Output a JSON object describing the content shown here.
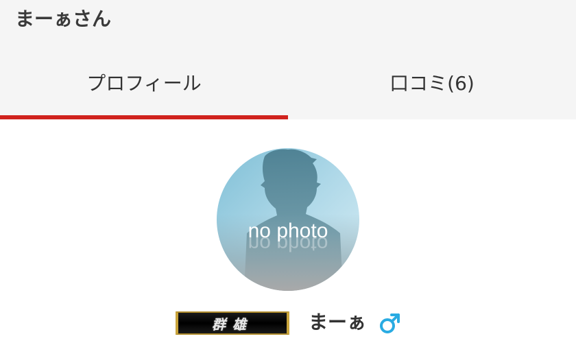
{
  "header": {
    "title": "まーぁさん"
  },
  "tabs": [
    {
      "label": "プロフィール",
      "active": true
    },
    {
      "label": "口コミ(6)",
      "active": false
    }
  ],
  "profile": {
    "avatar_text": "no photo",
    "rank_label": "群雄",
    "username": "まーぁ",
    "gender_icon": "male-icon"
  },
  "colors": {
    "accent": "#d0231e",
    "header_bg": "#f5f5f5",
    "male_blue": "#29abe2",
    "badge_gold": "#c9a43b"
  }
}
